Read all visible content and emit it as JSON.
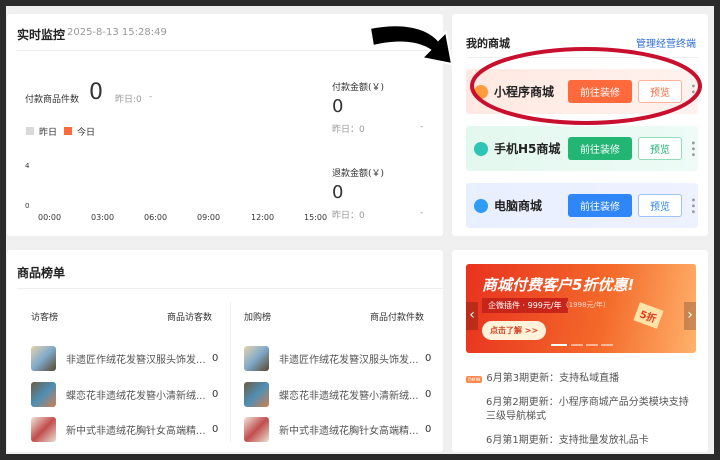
{
  "monitor": {
    "title": "实时监控",
    "timestamp": "2025-8-13 15:28:49",
    "items_label": "付款商品件数",
    "items_value": "0",
    "items_yesterday": "昨日:0",
    "items_trend": "-",
    "legend": [
      "昨日",
      "今日"
    ],
    "legend_colors": [
      "#d9d9d9",
      "#ff6a3d"
    ],
    "y_ticks": [
      "4",
      "0"
    ],
    "x_ticks": [
      "00:00",
      "03:00",
      "06:00",
      "09:00",
      "12:00",
      "15:00"
    ],
    "pay_label": "付款金额(￥)",
    "pay_value": "0",
    "pay_yesterday": "昨日：0",
    "pay_trend": "-",
    "refund_label": "退款金额(￥)",
    "refund_value": "0",
    "refund_yesterday": "昨日：0",
    "refund_trend": "-"
  },
  "shop": {
    "title": "我的商城",
    "manage_link": "管理经营终端",
    "stores": [
      {
        "name": "小程序商城",
        "decorate": "前往装修",
        "preview": "预览",
        "color": "#ff6a3d"
      },
      {
        "name": "手机H5商城",
        "decorate": "前往装修",
        "preview": "预览",
        "color": "#22b573"
      },
      {
        "name": "电脑商城",
        "decorate": "前往装修",
        "preview": "预览",
        "color": "#2f86f6"
      }
    ]
  },
  "rank": {
    "title": "商品榜单",
    "visitor": {
      "title": "访客榜",
      "col": "商品访客数",
      "rows": [
        {
          "name": "非遗匠作绒花发簪汉服头饰发...",
          "value": "0"
        },
        {
          "name": "蝶恋花非遗绒花发簪小清新绒...",
          "value": "0"
        },
        {
          "name": "新中式非遗绒花胸针女高端精...",
          "value": "0"
        }
      ]
    },
    "cart": {
      "title": "加购榜",
      "col": "商品付款件数",
      "rows": [
        {
          "name": "非遗匠作绒花发簪汉服头饰发...",
          "value": "0"
        },
        {
          "name": "蝶恋花非遗绒花发簪小清新绒...",
          "value": "0"
        },
        {
          "name": "新中式非遗绒花胸针女高端精...",
          "value": "0"
        }
      ]
    }
  },
  "news": {
    "banner": {
      "headline": "商城付费客户5折优惠!",
      "sub": "企微插件 · 999元/年",
      "orig": "(1998元/年)",
      "cta": "点击了解 >>",
      "badge": "5折",
      "prev": "‹",
      "next": "›"
    },
    "new_badge": "new",
    "items": [
      "6月第3期更新：支持私域直播",
      "6月第2期更新：小程序商城产品分类模块支持三级导航梯式",
      "6月第1期更新：支持批量发放礼品卡"
    ]
  }
}
